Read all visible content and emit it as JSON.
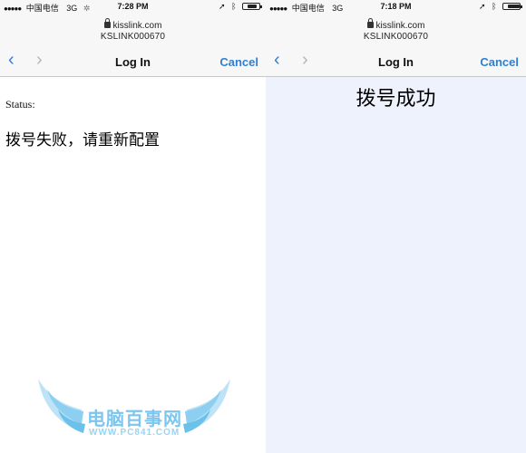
{
  "left": {
    "statusbar": {
      "signal": "●●●●●",
      "carrier": "中国电信",
      "network": "3G",
      "time": "7:28 PM",
      "battery_level": 0.65
    },
    "address": {
      "domain": "kisslink.com",
      "ssid": "KSLINK000670"
    },
    "nav": {
      "back": "‹",
      "forward": "›",
      "title": "Log In",
      "cancel": "Cancel"
    },
    "content": {
      "status_label": "Status:",
      "status_message": "拨号失败，请重新配置"
    }
  },
  "right": {
    "statusbar": {
      "signal": "●●●●●",
      "carrier": "中国电信",
      "network": "3G",
      "time": "7:18 PM",
      "battery_level": 0.8
    },
    "address": {
      "domain": "kisslink.com",
      "ssid": "KSLINK000670"
    },
    "nav": {
      "back": "‹",
      "forward": "›",
      "title": "Log In",
      "cancel": "Cancel"
    },
    "content": {
      "message": "拨号成功"
    }
  },
  "watermark": {
    "title": "电脑百事网",
    "subtitle": "WWW.PC841.COM"
  },
  "colors": {
    "accent": "#2f7fd1",
    "chrome_bg": "#f7f7f8",
    "right_bg": "#eef2fc",
    "watermark": "#7cc6ef"
  },
  "icons": [
    "lock-icon",
    "location-arrow-icon",
    "bluetooth-icon",
    "battery-icon",
    "loading-spinner-icon",
    "chevron-left-icon",
    "chevron-right-icon",
    "wing-icon"
  ]
}
